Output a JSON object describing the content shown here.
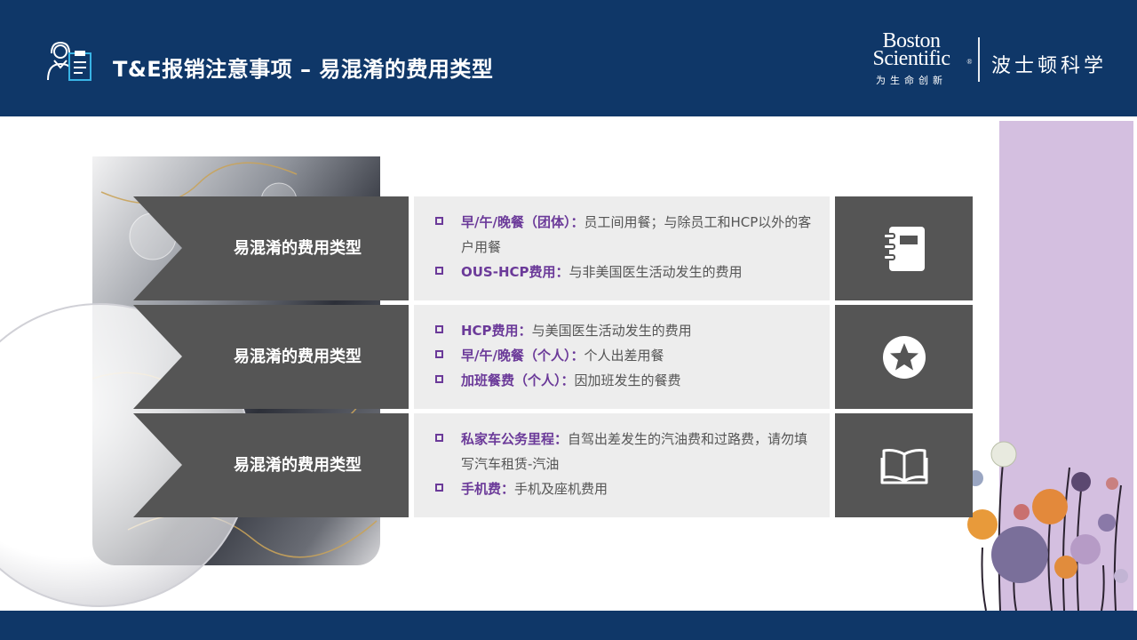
{
  "header": {
    "title": "T&E报销注意事项 – 易混淆的费用类型",
    "title_icon": "support-agent-clipboard-icon",
    "brand": {
      "name_line1": "Boston",
      "name_line2": "Scientific",
      "registered": "®",
      "slogan": "为生命创新",
      "name_cn": "波士顿科学"
    }
  },
  "rows": [
    {
      "label": "易混淆的费用类型",
      "icon": "notebook-icon",
      "bullets": [
        {
          "term": "早/午/晚餐（团体）：",
          "text": "员工间用餐；与除员工和HCP以外的客户用餐"
        },
        {
          "term": "OUS-HCP费用：",
          "text": "与非美国医生活动发生的费用"
        }
      ]
    },
    {
      "label": "易混淆的费用类型",
      "icon": "star-circle-icon",
      "bullets": [
        {
          "term": "HCP费用：",
          "text": "与美国医生活动发生的费用"
        },
        {
          "term": "早/午/晚餐（个人）：",
          "text": "个人出差用餐"
        },
        {
          "term": "加班餐费（个人）：",
          "text": "因加班发生的餐费"
        }
      ]
    },
    {
      "label": "易混淆的费用类型",
      "icon": "open-book-icon",
      "bullets": [
        {
          "term": "私家车公务里程：",
          "text": "自驾出差发生的汽油费和过路费，请勿填写汽车租赁-汽油"
        },
        {
          "term": "手机费：",
          "text": "手机及座机费用"
        }
      ]
    }
  ],
  "colors": {
    "header_bg": "#0f3768",
    "panel_dark": "#555555",
    "panel_light": "#ededed",
    "accent_purple": "#6b3a99",
    "lavender": "#d4bfe0"
  }
}
